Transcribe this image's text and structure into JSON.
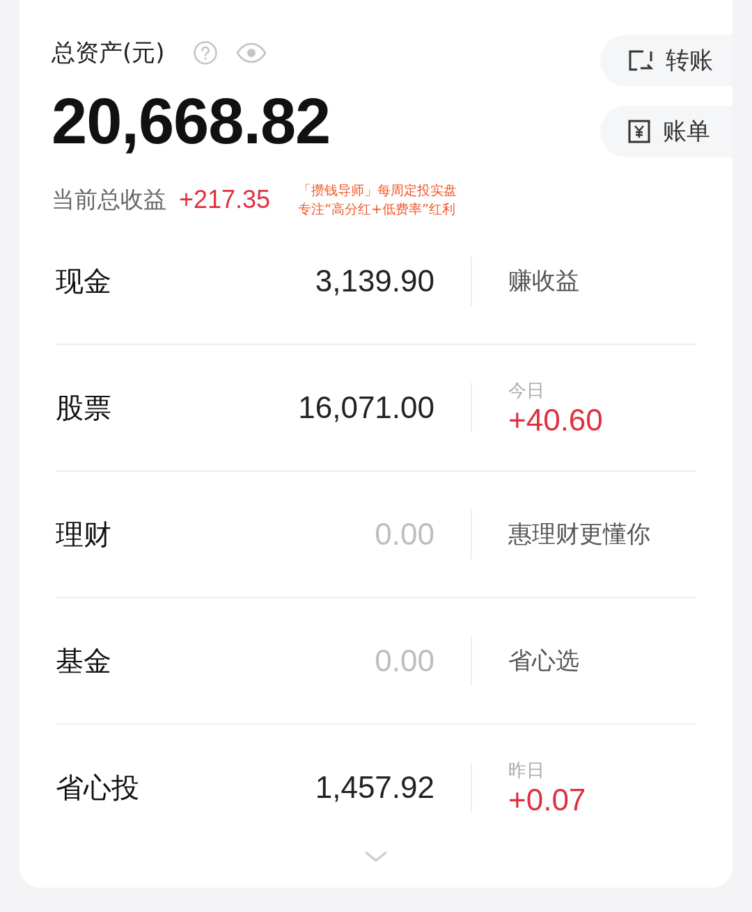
{
  "summary": {
    "title": "总资产(元)",
    "total": "20,668.82",
    "profit_label": "当前总收益",
    "profit": "+217.35"
  },
  "promo_note": [
    "「攒钱导师」每周定投实盘",
    "专注“高分红+低费率”红利"
  ],
  "actions": [
    {
      "label": "转账",
      "kind": "transfer"
    },
    {
      "label": "账单",
      "kind": "bill"
    }
  ],
  "assets": [
    {
      "name": "现金",
      "amount": "3,139.90",
      "dimmed": false,
      "kind": "link",
      "text": "赚收益"
    },
    {
      "name": "股票",
      "amount": "16,071.00",
      "dimmed": false,
      "kind": "change",
      "caption": "今日",
      "text": "+40.60"
    },
    {
      "name": "理财",
      "amount": "0.00",
      "dimmed": true,
      "kind": "link",
      "text": "惠理财更懂你"
    },
    {
      "name": "基金",
      "amount": "0.00",
      "dimmed": true,
      "kind": "link",
      "text": "省心选"
    },
    {
      "name": "省心投",
      "amount": "1,457.92",
      "dimmed": false,
      "kind": "change",
      "caption": "昨日",
      "text": "+0.07"
    }
  ]
}
